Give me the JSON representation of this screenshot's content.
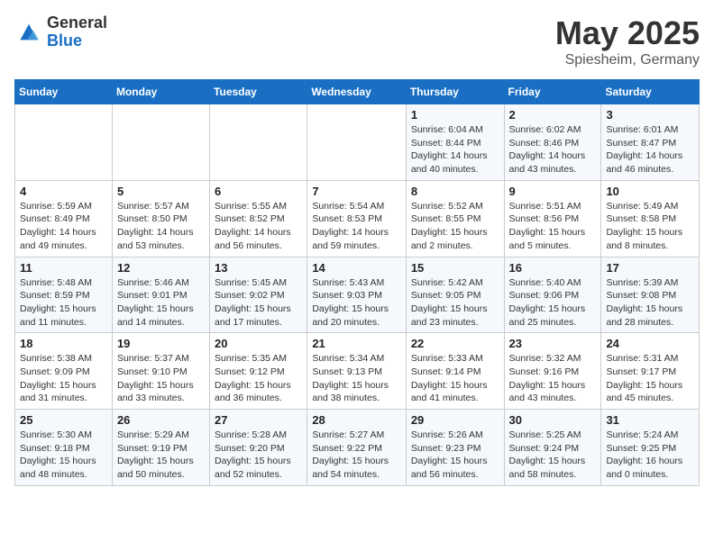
{
  "header": {
    "logo_general": "General",
    "logo_blue": "Blue",
    "month": "May 2025",
    "location": "Spiesheim, Germany"
  },
  "days_of_week": [
    "Sunday",
    "Monday",
    "Tuesday",
    "Wednesday",
    "Thursday",
    "Friday",
    "Saturday"
  ],
  "weeks": [
    [
      {
        "num": "",
        "info": ""
      },
      {
        "num": "",
        "info": ""
      },
      {
        "num": "",
        "info": ""
      },
      {
        "num": "",
        "info": ""
      },
      {
        "num": "1",
        "info": "Sunrise: 6:04 AM\nSunset: 8:44 PM\nDaylight: 14 hours\nand 40 minutes."
      },
      {
        "num": "2",
        "info": "Sunrise: 6:02 AM\nSunset: 8:46 PM\nDaylight: 14 hours\nand 43 minutes."
      },
      {
        "num": "3",
        "info": "Sunrise: 6:01 AM\nSunset: 8:47 PM\nDaylight: 14 hours\nand 46 minutes."
      }
    ],
    [
      {
        "num": "4",
        "info": "Sunrise: 5:59 AM\nSunset: 8:49 PM\nDaylight: 14 hours\nand 49 minutes."
      },
      {
        "num": "5",
        "info": "Sunrise: 5:57 AM\nSunset: 8:50 PM\nDaylight: 14 hours\nand 53 minutes."
      },
      {
        "num": "6",
        "info": "Sunrise: 5:55 AM\nSunset: 8:52 PM\nDaylight: 14 hours\nand 56 minutes."
      },
      {
        "num": "7",
        "info": "Sunrise: 5:54 AM\nSunset: 8:53 PM\nDaylight: 14 hours\nand 59 minutes."
      },
      {
        "num": "8",
        "info": "Sunrise: 5:52 AM\nSunset: 8:55 PM\nDaylight: 15 hours\nand 2 minutes."
      },
      {
        "num": "9",
        "info": "Sunrise: 5:51 AM\nSunset: 8:56 PM\nDaylight: 15 hours\nand 5 minutes."
      },
      {
        "num": "10",
        "info": "Sunrise: 5:49 AM\nSunset: 8:58 PM\nDaylight: 15 hours\nand 8 minutes."
      }
    ],
    [
      {
        "num": "11",
        "info": "Sunrise: 5:48 AM\nSunset: 8:59 PM\nDaylight: 15 hours\nand 11 minutes."
      },
      {
        "num": "12",
        "info": "Sunrise: 5:46 AM\nSunset: 9:01 PM\nDaylight: 15 hours\nand 14 minutes."
      },
      {
        "num": "13",
        "info": "Sunrise: 5:45 AM\nSunset: 9:02 PM\nDaylight: 15 hours\nand 17 minutes."
      },
      {
        "num": "14",
        "info": "Sunrise: 5:43 AM\nSunset: 9:03 PM\nDaylight: 15 hours\nand 20 minutes."
      },
      {
        "num": "15",
        "info": "Sunrise: 5:42 AM\nSunset: 9:05 PM\nDaylight: 15 hours\nand 23 minutes."
      },
      {
        "num": "16",
        "info": "Sunrise: 5:40 AM\nSunset: 9:06 PM\nDaylight: 15 hours\nand 25 minutes."
      },
      {
        "num": "17",
        "info": "Sunrise: 5:39 AM\nSunset: 9:08 PM\nDaylight: 15 hours\nand 28 minutes."
      }
    ],
    [
      {
        "num": "18",
        "info": "Sunrise: 5:38 AM\nSunset: 9:09 PM\nDaylight: 15 hours\nand 31 minutes."
      },
      {
        "num": "19",
        "info": "Sunrise: 5:37 AM\nSunset: 9:10 PM\nDaylight: 15 hours\nand 33 minutes."
      },
      {
        "num": "20",
        "info": "Sunrise: 5:35 AM\nSunset: 9:12 PM\nDaylight: 15 hours\nand 36 minutes."
      },
      {
        "num": "21",
        "info": "Sunrise: 5:34 AM\nSunset: 9:13 PM\nDaylight: 15 hours\nand 38 minutes."
      },
      {
        "num": "22",
        "info": "Sunrise: 5:33 AM\nSunset: 9:14 PM\nDaylight: 15 hours\nand 41 minutes."
      },
      {
        "num": "23",
        "info": "Sunrise: 5:32 AM\nSunset: 9:16 PM\nDaylight: 15 hours\nand 43 minutes."
      },
      {
        "num": "24",
        "info": "Sunrise: 5:31 AM\nSunset: 9:17 PM\nDaylight: 15 hours\nand 45 minutes."
      }
    ],
    [
      {
        "num": "25",
        "info": "Sunrise: 5:30 AM\nSunset: 9:18 PM\nDaylight: 15 hours\nand 48 minutes."
      },
      {
        "num": "26",
        "info": "Sunrise: 5:29 AM\nSunset: 9:19 PM\nDaylight: 15 hours\nand 50 minutes."
      },
      {
        "num": "27",
        "info": "Sunrise: 5:28 AM\nSunset: 9:20 PM\nDaylight: 15 hours\nand 52 minutes."
      },
      {
        "num": "28",
        "info": "Sunrise: 5:27 AM\nSunset: 9:22 PM\nDaylight: 15 hours\nand 54 minutes."
      },
      {
        "num": "29",
        "info": "Sunrise: 5:26 AM\nSunset: 9:23 PM\nDaylight: 15 hours\nand 56 minutes."
      },
      {
        "num": "30",
        "info": "Sunrise: 5:25 AM\nSunset: 9:24 PM\nDaylight: 15 hours\nand 58 minutes."
      },
      {
        "num": "31",
        "info": "Sunrise: 5:24 AM\nSunset: 9:25 PM\nDaylight: 16 hours\nand 0 minutes."
      }
    ]
  ]
}
